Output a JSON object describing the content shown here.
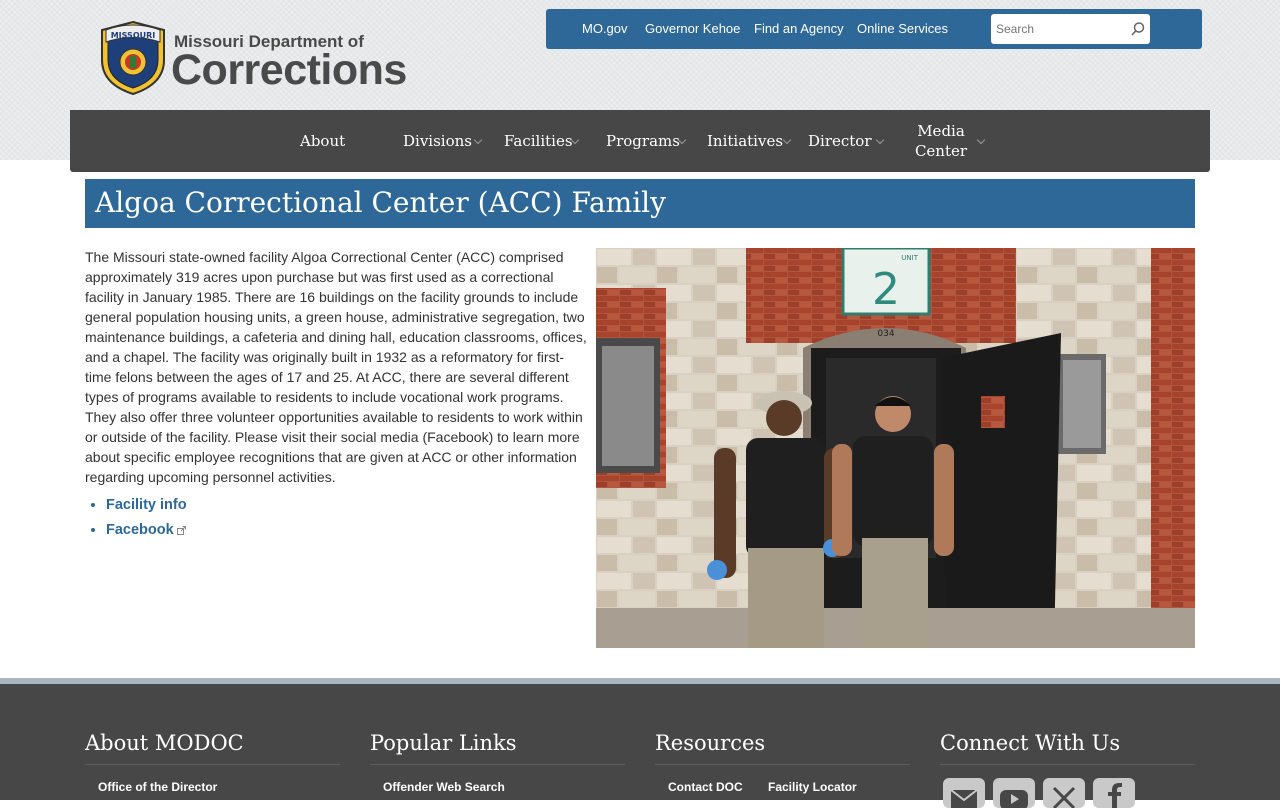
{
  "header": {
    "logo_line1": "Missouri Department of",
    "logo_line2": "Corrections",
    "seal_text": "MISSOURI DEPARTMENT OF CORRECTIONS",
    "utility_links": [
      "MO.gov",
      "Governor Kehoe",
      "Find an Agency",
      "Online Services"
    ],
    "search": {
      "placeholder": "Search",
      "value": ""
    }
  },
  "nav": {
    "items": [
      {
        "label": "About"
      },
      {
        "label": "Divisions"
      },
      {
        "label": "Facilities"
      },
      {
        "label": "Programs"
      },
      {
        "label": "Initiatives"
      },
      {
        "label": "Director"
      },
      {
        "label_line1": "Media",
        "label_line2": "Center"
      }
    ]
  },
  "page": {
    "title": "Algoa Correctional Center (ACC) Family",
    "body": "The Missouri state-owned facility Algoa Correctional Center (ACC) comprised approximately 319 acres upon purchase but was first used as a correctional facility in January 1985. There are 16 buildings on the facility grounds to include general population housing units, a green house, administrative segregation, two maintenance buildings, a cafeteria and dining hall, education classrooms, offices, and a chapel. The facility was originally built in 1932 as a reformatory for first-time felons between the ages of 17 and 25. At ACC, there are several different types of programs available to residents to include vocational work programs. They also offer three volunteer opportunities available to residents to work within or outside of the facility.  Please visit their social media (Facebook) to learn more about specific employee recognitions that are given at ACC or other information regarding upcoming personnel activities.",
    "links": [
      "Facility info",
      "Facebook"
    ],
    "photo": {
      "unit_sign": "2",
      "unit_label": "UNIT",
      "door_number": "034"
    }
  },
  "footer": {
    "columns": [
      {
        "heading": "About MODOC",
        "links": [
          "Office of the Director"
        ]
      },
      {
        "heading": "Popular Links",
        "links": [
          "Offender Web Search"
        ]
      },
      {
        "heading": "Resources",
        "links": [
          "Contact DOC",
          "Facility Locator"
        ]
      },
      {
        "heading": "Connect With Us",
        "social": [
          "email-icon",
          "youtube-icon",
          "x-icon",
          "facebook-icon"
        ]
      }
    ]
  },
  "colors": {
    "primary_blue": "#2d6898",
    "nav_gray": "#474747",
    "footer_accent": "#a9b6bf"
  }
}
